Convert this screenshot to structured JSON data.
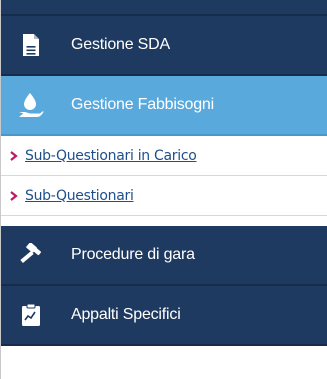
{
  "menu": {
    "items": [
      {
        "label": "Gestione SDA",
        "icon": "document-icon",
        "active": false
      },
      {
        "label": "Gestione Fabbisogni",
        "icon": "hand-drop-icon",
        "active": true
      },
      {
        "label": "Procedure di gara",
        "icon": "gavel-icon",
        "active": false
      },
      {
        "label": "Appalti Specifici",
        "icon": "clipboard-chart-icon",
        "active": false
      }
    ],
    "subitems": [
      {
        "label": "Sub-Questionari in Carico",
        "icon": "chevron-right-icon"
      },
      {
        "label": "Sub-Questionari",
        "icon": "chevron-right-icon"
      }
    ]
  },
  "colors": {
    "nav_bg": "#1f3a60",
    "active_bg": "#5aa9dd",
    "link": "#1f4f8a",
    "bullet": "#c0185f"
  }
}
